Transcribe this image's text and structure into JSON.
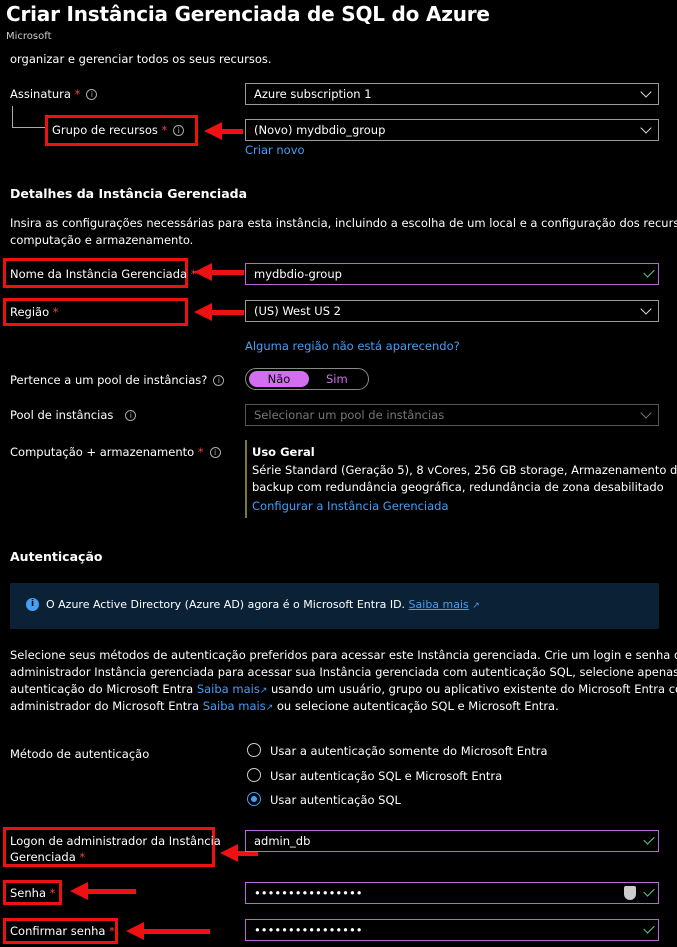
{
  "header": {
    "title": "Criar Instância Gerenciada de SQL do Azure",
    "more": "···",
    "publisher": "Microsoft"
  },
  "intro": "organizar e gerenciar todos os seus recursos.",
  "subscription": {
    "label": "Assinatura",
    "required": "*",
    "value": "Azure subscription 1"
  },
  "resource_group": {
    "label": "Grupo de recursos",
    "required": "*",
    "value": "(Novo) mydbdio_group",
    "create_new": "Criar novo"
  },
  "details": {
    "heading": "Detalhes da Instância Gerenciada",
    "description_line1": "Insira as configurações necessárias para esta instância, incluindo a escolha de um local e a configuração dos recursos de",
    "description_line2": "computação e armazenamento."
  },
  "instance_name": {
    "label": "Nome da Instância Gerenciada",
    "required": "*",
    "value": "mydbdio-group"
  },
  "region": {
    "label": "Região",
    "required": "*",
    "value": "(US) West US 2",
    "missing_link": "Alguma região não está aparecendo?"
  },
  "pool_member": {
    "label": "Pertence a um pool de instâncias?",
    "option_no": "Não",
    "option_yes": "Sim",
    "selected": "Não"
  },
  "pool": {
    "label": "Pool de instâncias",
    "placeholder": "Selecionar um pool de instâncias"
  },
  "compute": {
    "label": "Computação + armazenamento",
    "required": "*",
    "tier": "Uso Geral",
    "line1": "Série Standard (Geração 5), 8 vCores, 256 GB storage, Armazenamento de",
    "line2": "backup com redundância geográfica, redundância de zona desabilitado",
    "configure_link": "Configurar a Instância Gerenciada"
  },
  "auth": {
    "heading": "Autenticação",
    "banner_icon": "info-icon",
    "banner_text": "O Azure Active Directory (Azure AD) agora é o Microsoft Entra ID.",
    "banner_link": "Saiba mais",
    "para_line1": "Selecione seus métodos de autenticação preferidos para acessar este Instância gerenciada. Crie um login e senha de",
    "para_line2": "administrador Instância gerenciada para acessar sua Instância gerenciada com autenticação SQL, selecione apenas",
    "para_line3a": "autenticação do Microsoft Entra",
    "para_link1": "Saiba mais",
    "para_line3b": "usando um usuário, grupo ou aplicativo existente do Microsoft Entra como",
    "para_line4a": "administrador do Microsoft Entra",
    "para_link2": "Saiba mais",
    "para_line4b": "ou selecione autenticação SQL e Microsoft Entra.",
    "method_label": "Método de autenticação",
    "options": [
      "Usar a autenticação somente do Microsoft Entra",
      "Usar autenticação SQL e Microsoft Entra",
      "Usar autenticação SQL"
    ],
    "selected_option": "Usar autenticação SQL"
  },
  "admin_login": {
    "label_line1": "Logon de administrador da Instância",
    "label_line2": "Gerenciada",
    "required": "*",
    "value": "admin_db"
  },
  "password": {
    "label": "Senha",
    "required": "*",
    "value": "••••••••••••••••"
  },
  "confirm_password": {
    "label": "Confirmar senha",
    "required": "*",
    "value": "••••••••••••••••"
  },
  "colors": {
    "accent": "#479ef5",
    "toggle": "#d36ef0",
    "annotation": "#e11111",
    "valid": "#5fd38a"
  }
}
